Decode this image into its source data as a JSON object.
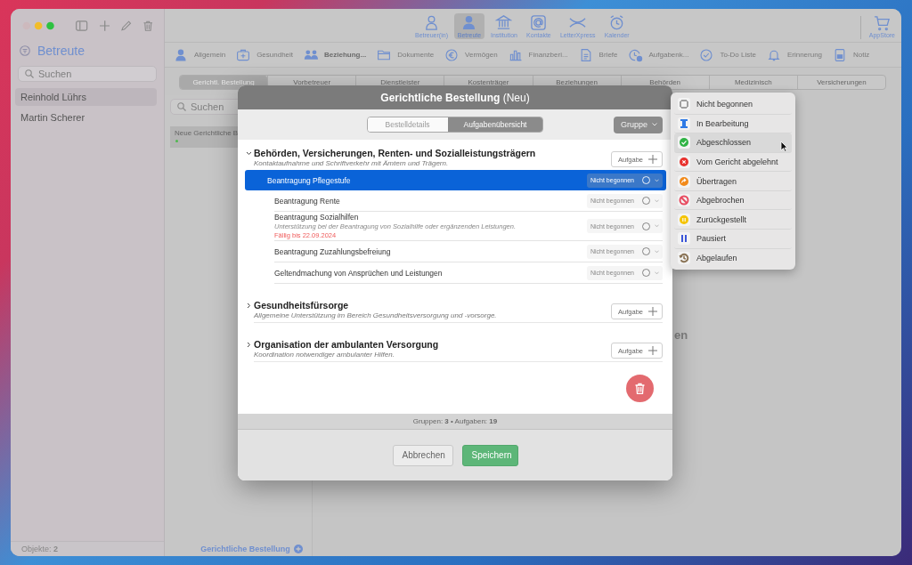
{
  "sidebar": {
    "title": "Betreute",
    "search": {
      "placeholder": "Suchen"
    },
    "items": [
      {
        "label": "Reinhold Lührs",
        "selected": true
      },
      {
        "label": "Martin Scherer",
        "selected": false
      }
    ],
    "footer": "Objekte: **2**"
  },
  "toolbar": {
    "items": [
      {
        "label": "Betreuer(in)",
        "kind": "person-outline",
        "selected": false
      },
      {
        "label": "Betreute",
        "kind": "person",
        "selected": true
      },
      {
        "label": "Institution",
        "kind": "building",
        "selected": false
      },
      {
        "label": "Kontakte",
        "kind": "at",
        "selected": false
      },
      {
        "label": "LetterXpress",
        "kind": "arrows",
        "selected": false
      },
      {
        "label": "Kalender",
        "kind": "alarm",
        "selected": false
      }
    ],
    "store": {
      "label": "AppStore"
    }
  },
  "categories": [
    {
      "label": "Allgemein",
      "kind": "person",
      "selected": false
    },
    {
      "label": "Gesundheit",
      "kind": "medkit",
      "selected": false
    },
    {
      "label": "Beziehung...",
      "kind": "people",
      "selected": true
    },
    {
      "label": "Dokumente",
      "kind": "folder",
      "selected": false
    },
    {
      "label": "Vermögen",
      "kind": "euro",
      "selected": false
    },
    {
      "label": "Finanzberi...",
      "kind": "chart",
      "selected": false
    },
    {
      "label": "Briefe",
      "kind": "document",
      "selected": false
    },
    {
      "label": "Aufgabenk...",
      "kind": "clock-check",
      "selected": false
    },
    {
      "label": "To-Do Liste",
      "kind": "check",
      "selected": false
    },
    {
      "label": "Erinnerung",
      "kind": "bell",
      "selected": false
    },
    {
      "label": "Notiz",
      "kind": "note",
      "selected": false
    }
  ],
  "subtabs": [
    {
      "label": "Gerichtl. Bestellung",
      "selected": true
    },
    {
      "label": "Vorbetreuer",
      "selected": false
    },
    {
      "label": "Dienstleister",
      "selected": false
    },
    {
      "label": "Kostenträger",
      "selected": false
    },
    {
      "label": "Beziehungen",
      "selected": false
    },
    {
      "label": "Behörden",
      "selected": false
    },
    {
      "label": "Medizinisch",
      "selected": false
    },
    {
      "label": "Versicherungen",
      "selected": false
    }
  ],
  "list": {
    "search": {
      "placeholder": "Suchen"
    },
    "items": [
      {
        "label": "Neue Gerichtliche B",
        "selected": true
      }
    ],
    "footer": "Gerichtliche Bestellung"
  },
  "detail_fragment": "en",
  "dialog": {
    "title": "**Gerichtliche Bestellung** (Neu)",
    "segments": [
      {
        "label": "Bestelldetails",
        "selected": false
      },
      {
        "label": "Aufgabenübersicht",
        "selected": true
      }
    ],
    "group_button": "Gruppe",
    "groups": [
      {
        "title": "Behörden, Versicherungen, Renten- und Sozialleistungsträgern",
        "description": "Kontaktaufnahme und Schriftverkehr mit Ämtern und Trägern.",
        "expanded": true,
        "add_button": "Aufgabe",
        "tasks": [
          {
            "title": "Beantragung Pflegestufe",
            "status": "Nicht begonnen",
            "selected": true
          },
          {
            "title": "Beantragung Rente",
            "status": "Nicht begonnen",
            "selected": false
          },
          {
            "title": "Beantragung Sozialhilfen",
            "description": "Unterstützung bei der Beantragung von Sozialhilfe oder ergänzenden Leistungen.",
            "due": "Fällig bis 22.09.2024",
            "status": "Nicht begonnen",
            "selected": false
          },
          {
            "title": "Beantragung Zuzahlungsbefreiung",
            "status": "Nicht begonnen",
            "selected": false
          },
          {
            "title": "Geltendmachung von Ansprüchen und Leistungen",
            "status": "Nicht begonnen",
            "selected": false
          }
        ]
      },
      {
        "title": "Gesundheitsfürsorge",
        "description": "Allgemeine Unterstützung im Bereich Gesundheitsversorgung und -vorsorge.",
        "expanded": false,
        "add_button": "Aufgabe"
      },
      {
        "title": "Organisation der ambulanten Versorgung",
        "description": "Koordination notwendiger ambulanter Hilfen.",
        "expanded": false,
        "add_button": "Aufgabe"
      }
    ],
    "summary": "Gruppen: **3** • Aufgaben: **19**",
    "buttons": [
      {
        "label": "Abbrechen",
        "kind": "secondary"
      },
      {
        "label": "Speichern",
        "kind": "primary"
      }
    ]
  },
  "status_menu": {
    "items": [
      {
        "label": "Nicht begonnen",
        "kind": "ring",
        "color": "#a0a0a0",
        "selected": false
      },
      {
        "label": "In Bearbeitung",
        "kind": "hourglass",
        "color": "#2f7ae5",
        "selected": false
      },
      {
        "label": "Abgeschlossen",
        "kind": "check-badge",
        "color": "#2fb344",
        "selected": true
      },
      {
        "label": "Vom Gericht abgelehnt",
        "kind": "x-badge",
        "color": "#e8322e",
        "selected": false
      },
      {
        "label": "Übertragen",
        "kind": "forward",
        "color": "#f28a1a",
        "selected": false
      },
      {
        "label": "Abgebrochen",
        "kind": "prohibit",
        "color": "#e84a5f",
        "selected": false
      },
      {
        "label": "Zurückgestellt",
        "kind": "pause-circle",
        "color": "#f5c400",
        "selected": false
      },
      {
        "label": "Pausiert",
        "kind": "pause",
        "color": "#3b55d9",
        "selected": false
      },
      {
        "label": "Abgelaufen",
        "kind": "history",
        "color": "#8a7355",
        "selected": false
      }
    ]
  }
}
